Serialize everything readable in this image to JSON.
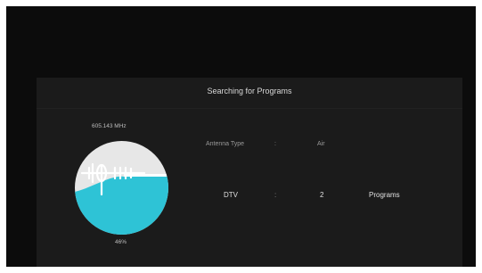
{
  "panel": {
    "title": "Searching for Programs"
  },
  "scan": {
    "frequency": "605.143 MHz",
    "progress_label": "46%",
    "progress_fraction": 0.46
  },
  "details": {
    "antenna_label": "Antenna Type",
    "antenna_separator": ":",
    "antenna_value": "Air",
    "dtv_label": "DTV",
    "dtv_separator": ":",
    "dtv_count": "2",
    "dtv_unit": "Programs"
  },
  "colors": {
    "accent": "#2ec3d6",
    "gauge_bg": "#e7e7e7"
  },
  "icons": {
    "antenna": "antenna-icon"
  }
}
